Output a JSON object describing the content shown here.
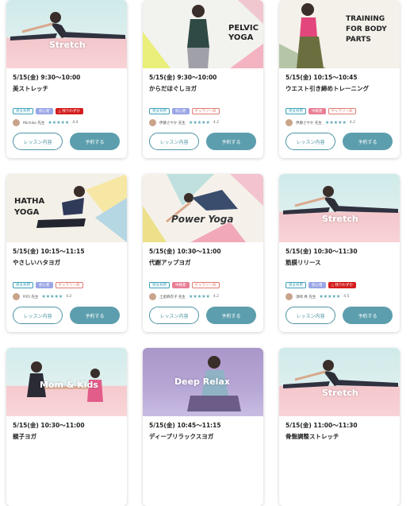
{
  "buttons": {
    "detail": "レッスン内容",
    "reserve": "予約する"
  },
  "cards": [
    {
      "thumb_title": "Stretch",
      "date": "5/15(金) 9:30～10:00",
      "name": "美ストレッチ",
      "tags": [
        {
          "text": "男女共用",
          "kind": "blue"
        },
        {
          "text": "初心者",
          "kind": "purple"
        },
        {
          "text": "△ 残りわずか",
          "kind": "red"
        }
      ],
      "instructor": "Michiko 先生",
      "stars": "★★★★★",
      "rating": "4.4"
    },
    {
      "thumb_title": "PELVIC YOGA",
      "date": "5/15(金) 9:30～10:00",
      "name": "からだほぐしヨガ",
      "tags": [
        {
          "text": "男女共用",
          "kind": "blue"
        },
        {
          "text": "初心者",
          "kind": "purple"
        },
        {
          "text": "ギャラリー枠",
          "kind": "gallery"
        }
      ],
      "instructor": "伊藤さやか 先生",
      "stars": "★★★★★",
      "rating": "4.2"
    },
    {
      "thumb_title": "TRAINING FOR BODY PARTS",
      "date": "5/15(金) 10:15～10:45",
      "name": "ウエスト引き締めトレーニング",
      "tags": [
        {
          "text": "男女共用",
          "kind": "blue"
        },
        {
          "text": "中級者",
          "kind": "pink"
        },
        {
          "text": "ギャラリー枠",
          "kind": "gallery"
        }
      ],
      "instructor": "伊藤さやか 先生",
      "stars": "★★★★★",
      "rating": "4.2"
    },
    {
      "thumb_title": "HATHA YOGA",
      "date": "5/15(金) 10:15～11:15",
      "name": "やさしいハタヨガ",
      "tags": [
        {
          "text": "男女共用",
          "kind": "blue"
        },
        {
          "text": "初心者",
          "kind": "purple"
        },
        {
          "text": "ギャラリー枠",
          "kind": "gallery"
        }
      ],
      "instructor": "RYO 先生",
      "stars": "★★★★★",
      "rating": "4.2"
    },
    {
      "thumb_title": "Power Yoga",
      "date": "5/15(金) 10:30～11:00",
      "name": "代謝アップヨガ",
      "tags": [
        {
          "text": "男女共用",
          "kind": "blue"
        },
        {
          "text": "中級者",
          "kind": "pink"
        },
        {
          "text": "ギャラリー枠",
          "kind": "gallery"
        }
      ],
      "instructor": "土屋麻衣子 先生",
      "stars": "★★★★★",
      "rating": "4.2"
    },
    {
      "thumb_title": "Stretch",
      "date": "5/15(金) 10:30～11:30",
      "name": "筋膜リリース",
      "tags": [
        {
          "text": "男女共用",
          "kind": "blue"
        },
        {
          "text": "初心者",
          "kind": "purple"
        },
        {
          "text": "△ 残りわずか",
          "kind": "red"
        }
      ],
      "instructor": "須崎 秀 先生",
      "stars": "★★★★★",
      "rating": "4.5"
    },
    {
      "thumb_title": "Mom & Kids",
      "date": "5/15(金) 10:30～11:00",
      "name": "親子ヨガ",
      "tags": [],
      "instructor": "",
      "stars": "",
      "rating": ""
    },
    {
      "thumb_title": "Deep Relax",
      "date": "5/15(金) 10:45～11:15",
      "name": "ディープリラックスヨガ",
      "tags": [],
      "instructor": "",
      "stars": "",
      "rating": ""
    },
    {
      "thumb_title": "Stretch",
      "date": "5/15(金) 11:00～11:30",
      "name": "骨盤調整ストレッチ",
      "tags": [],
      "instructor": "",
      "stars": "",
      "rating": ""
    }
  ]
}
